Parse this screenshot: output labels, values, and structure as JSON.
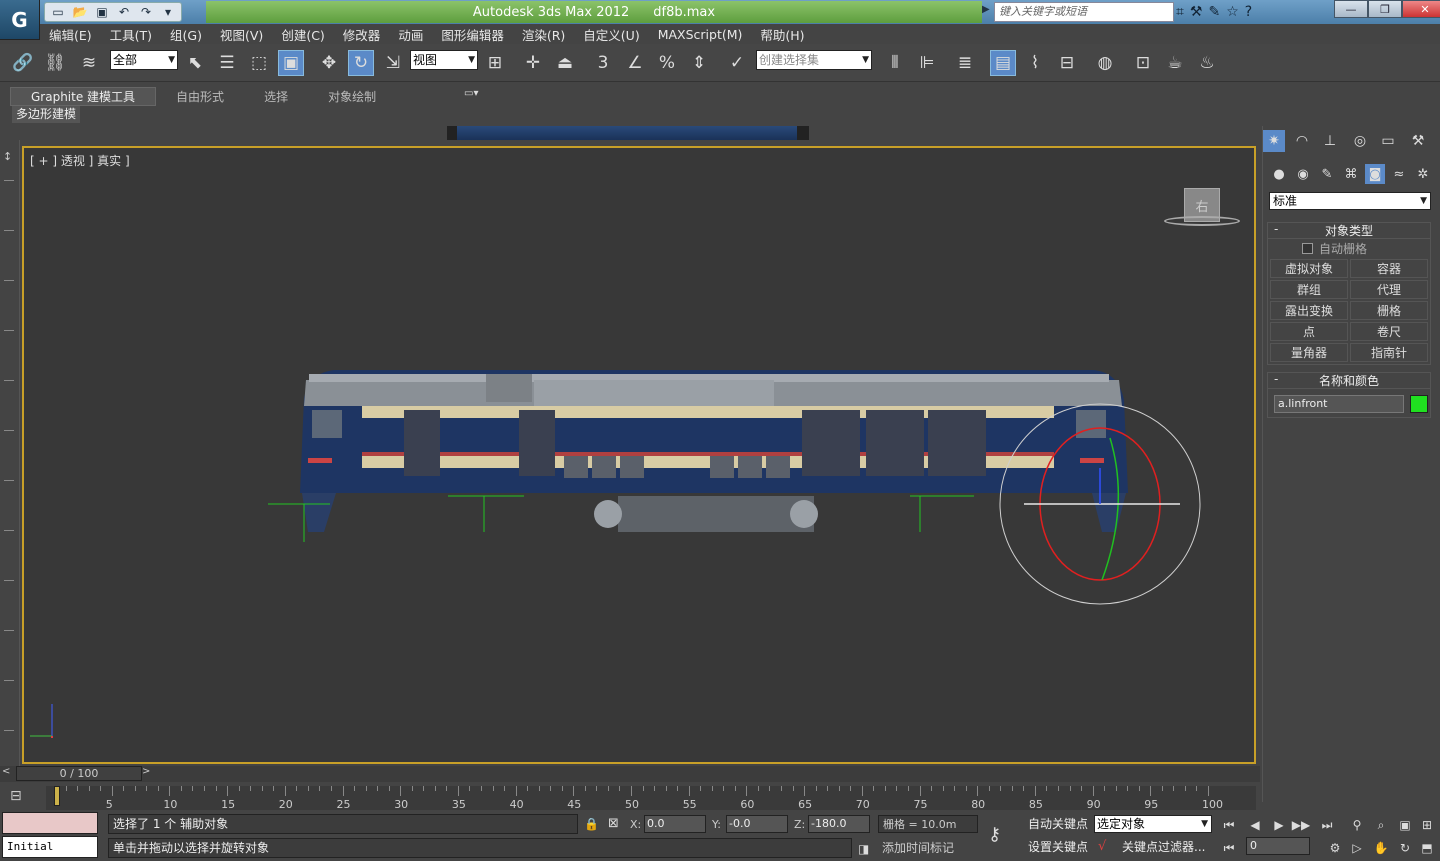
{
  "app": {
    "product": "Autodesk 3ds Max  2012",
    "file": "df8b.max",
    "search_placeholder": "键入关键字或短语"
  },
  "menu": [
    "编辑(E)",
    "工具(T)",
    "组(G)",
    "视图(V)",
    "创建(C)",
    "修改器",
    "动画",
    "图形编辑器",
    "渲染(R)",
    "自定义(U)",
    "MAXScript(M)",
    "帮助(H)"
  ],
  "toolbar": {
    "filter_value": "全部",
    "refcoord_value": "视图",
    "named_selection_placeholder": "创建选择集",
    "snap_label": "3",
    "angle_label": "%"
  },
  "ribbon": {
    "tabs": [
      "Graphite 建模工具",
      "自由形式",
      "选择",
      "对象绘制"
    ],
    "subtab": "多边形建模"
  },
  "viewport": {
    "label": "[ + ] 透视 ] 真实 ]",
    "viewcube_face": "右"
  },
  "command_panel": {
    "category": "标准",
    "object_type": {
      "title": "对象类型",
      "autogrid": "自动栅格",
      "buttons": [
        "虚拟对象",
        "容器",
        "群组",
        "代理",
        "露出变换",
        "栅格",
        "点",
        "卷尺",
        "量角器",
        "指南针"
      ]
    },
    "name_color": {
      "title": "名称和颜色",
      "name": "a.linfront",
      "color": "#20e020"
    }
  },
  "timeline": {
    "slider": "0 / 100",
    "ticks": [
      "5",
      "10",
      "15",
      "20",
      "25",
      "30",
      "35",
      "40",
      "45",
      "50",
      "55",
      "60",
      "65",
      "70",
      "75",
      "80",
      "85",
      "90",
      "95",
      "100"
    ]
  },
  "status": {
    "maxscript": "Initial Cluster",
    "line1": "选择了 1 个 辅助对象",
    "line2": "单击并拖动以选择并旋转对象",
    "x_label": "X:",
    "x": "0.0",
    "y_label": "Y:",
    "y": "-0.0",
    "z_label": "Z:",
    "z": "-180.0",
    "grid": "栅格 = 10.0m",
    "add_time_tag": "添加时间标记",
    "auto_key": "自动关键点",
    "set_key": "设置关键点",
    "key_mode": "选定对象",
    "key_filters": "关键点过滤器...",
    "frame": "0"
  }
}
